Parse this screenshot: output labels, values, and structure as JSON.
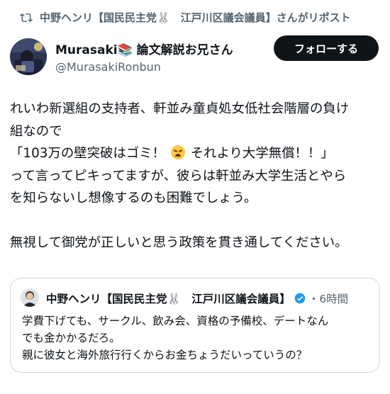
{
  "repost": {
    "text": "中野ヘンリ【国民民主党🐰　江戸川区議会議員】さんがリポスト",
    "icon": "repost-icon"
  },
  "author": {
    "name": "Murasaki📚 論文解説お兄さん",
    "handle": "@MurasakiRonbun"
  },
  "follow_label": "フォローする",
  "post": {
    "line1": "れいわ新選組の支持者、軒並み童貞処女低社会階層の負け",
    "line2": "組なので",
    "line3a": "「103万の壁突破はゴミ！",
    "line3b": "それより大学無償！！」",
    "line4": "って言ってピキってますが、彼らは軒並み大学生活とやら",
    "line5": "を知らないし想像するのも困難でしょう。",
    "line6": "無視して御党が正しいと思う政策を貫き通してください。"
  },
  "quote": {
    "name": "中野ヘンリ【国民民主党🐰　江戸川区議会議員】",
    "time": "・6時間",
    "line1": "学費下げても、サークル、飲み会、資格の予備校、デートなん",
    "line2": "でも金かかるだろ。",
    "line3": "親に彼女と海外旅行行くからお金ちょうだいっていうの？"
  },
  "colors": {
    "text": "#0f1419",
    "secondary": "#536471",
    "border": "#cfd9de",
    "verified": "#1d9bf0",
    "follow_bg": "#0f1419"
  }
}
